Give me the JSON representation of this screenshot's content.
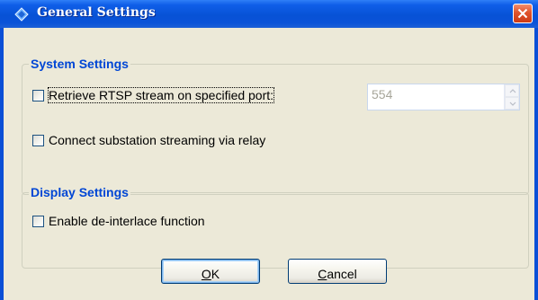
{
  "window": {
    "title": "General Settings"
  },
  "system_settings": {
    "heading": "System Settings",
    "rtsp": {
      "label": "Retrieve RTSP stream on specified port:",
      "checked": false,
      "port_value": "554"
    },
    "relay": {
      "label": "Connect substation streaming via relay",
      "checked": false
    }
  },
  "display_settings": {
    "heading": "Display Settings",
    "deinterlace": {
      "label": "Enable de-interlace function",
      "checked": false
    }
  },
  "buttons": {
    "ok_mnemonic": "O",
    "ok_rest": "K",
    "cancel_mnemonic": "C",
    "cancel_rest": "ancel"
  },
  "colors": {
    "title_bar": "#0a53d8",
    "dialog_face": "#ece9d8",
    "group_heading": "#0046d5",
    "close_button": "#e0542c"
  },
  "icons": {
    "app": "diamond-app-icon",
    "close": "close-icon",
    "spin_up": "chevron-up-icon",
    "spin_down": "chevron-down-icon"
  }
}
